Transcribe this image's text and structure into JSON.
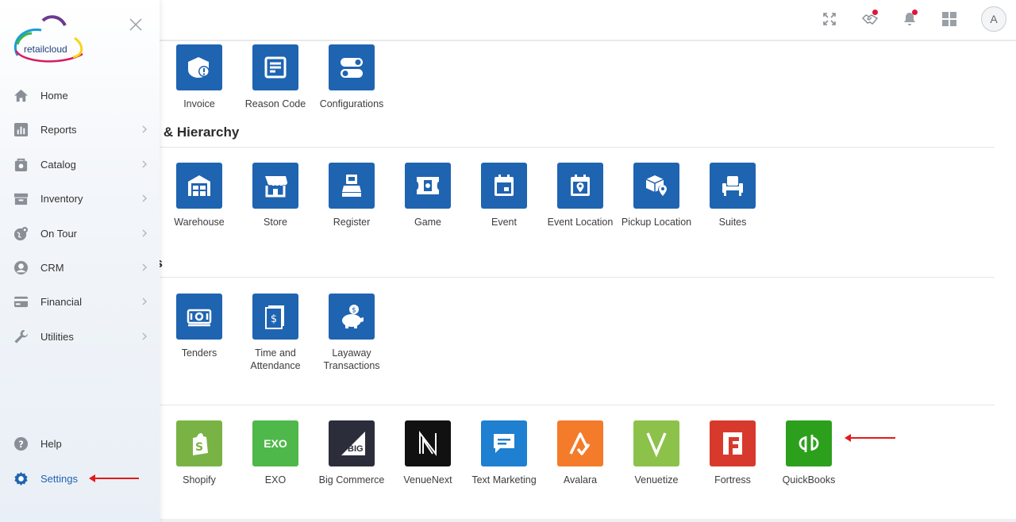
{
  "brand": {
    "logo_text": "retailcloud"
  },
  "topbar": {
    "avatar_initial": "A"
  },
  "sidebar": {
    "items": [
      {
        "label": "Home"
      },
      {
        "label": "Reports"
      },
      {
        "label": "Catalog"
      },
      {
        "label": "Inventory"
      },
      {
        "label": "On Tour"
      },
      {
        "label": "CRM"
      },
      {
        "label": "Financial"
      },
      {
        "label": "Utilities"
      }
    ],
    "help_label": "Help",
    "settings_label": "Settings"
  },
  "sections": {
    "location_title": "tion & Hierarchy",
    "settings_title": "ings"
  },
  "tiles": {
    "invoice": "Invoice",
    "reason_code": "Reason Code",
    "configurations": "Configurations",
    "warehouse": "Warehouse",
    "store": "Store",
    "register": "Register",
    "game": "Game",
    "event": "Event",
    "event_location": "Event Location",
    "pickup_location": "Pickup Location",
    "suites": "Suites",
    "tenders": "Tenders",
    "time_attendance": "Time and Attendance",
    "layaway": "Layaway Transactions"
  },
  "integrations": {
    "shopify": "Shopify",
    "exo": "EXO",
    "bigcommerce": "Big Commerce",
    "bigcommerce_mark": "BIG",
    "venuenext": "VenueNext",
    "text_marketing": "Text Marketing",
    "avalara": "Avalara",
    "venuetize": "Venuetize",
    "fortress": "Fortress",
    "quickbooks": "QuickBooks",
    "exo_mark": "EXO"
  },
  "colors": {
    "tile_blue": "#1f64b1",
    "shopify": "#7ab345",
    "exo": "#4fb84a",
    "bigcommerce": "#2b2d3a",
    "venuenext": "#111111",
    "text_marketing": "#1f7fd0",
    "avalara": "#f47b2a",
    "venuetize": "#8cc24a",
    "fortress": "#d73a2c",
    "quickbooks": "#2ca01c",
    "accent": "#1f64b1",
    "annotation_arrow": "#e21b1b"
  }
}
